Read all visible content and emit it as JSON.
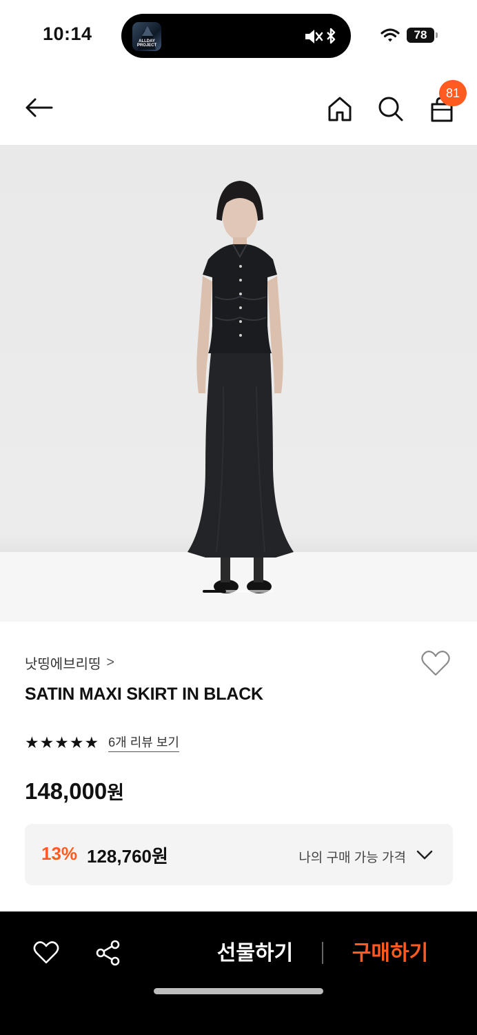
{
  "status_bar": {
    "time": "10:14",
    "battery": "78",
    "island_app_name": "ALLDAY PROJECT"
  },
  "nav": {
    "back_icon": "arrow-left-icon",
    "home_icon": "home-icon",
    "search_icon": "search-icon",
    "cart_icon": "shopping-bag-icon",
    "cart_count": "81"
  },
  "product": {
    "brand": "낫띵에브리띵",
    "brand_chevron": ">",
    "title": "SATIN MAXI SKIRT IN BLACK",
    "rating_stars": 5,
    "review_link": "6개 리뷰 보기",
    "price": "148,000",
    "price_unit": "원",
    "image_pages": 3,
    "image_current_page": 1
  },
  "my_price": {
    "discount": "13%",
    "price": "128,760원",
    "label": "나의 구매 가능 가격"
  },
  "bottom_bar": {
    "gift_label": "선물하기",
    "buy_label": "구매하기"
  },
  "colors": {
    "accent": "#ff5a1f",
    "text": "#111111",
    "bottom_bar": "#000000"
  }
}
